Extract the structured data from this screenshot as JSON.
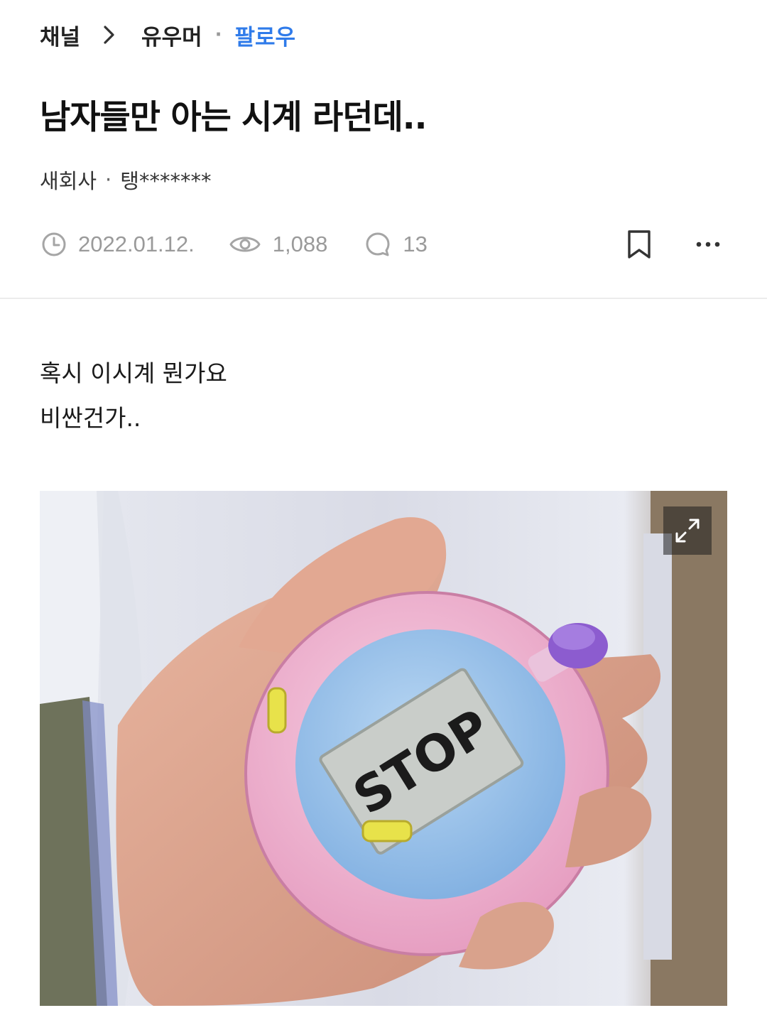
{
  "breadcrumb": {
    "channel": "채널",
    "category": "유우머",
    "follow": "팔로우"
  },
  "post": {
    "title": "남자들만 아는 시계 라던데..",
    "board": "새회사",
    "author": "탱*******",
    "date": "2022.01.12.",
    "views": "1,088",
    "comments": "13",
    "body_lines": [
      "혹시 이시계 뭔가요",
      "비싼건가.."
    ]
  },
  "photo": {
    "display_text": "STOP"
  },
  "icons": {
    "chevron": "chevron-right-icon",
    "clock": "clock-icon",
    "eye": "eye-icon",
    "comment": "comment-bubble-icon",
    "bookmark": "bookmark-icon",
    "more": "more-dots-icon",
    "expand": "expand-icon"
  },
  "colors": {
    "accent": "#2f7bea",
    "meta_gray": "#9a9a9a",
    "divider": "#ececec"
  }
}
